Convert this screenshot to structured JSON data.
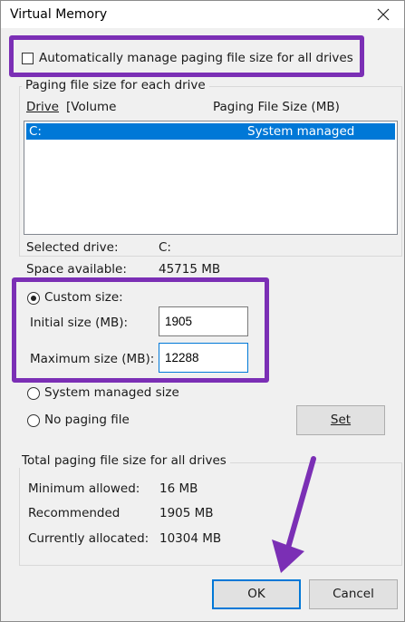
{
  "window": {
    "title": "Virtual Memory"
  },
  "auto_manage": {
    "label": "Automatically manage paging file size for all drives",
    "checked": false
  },
  "drives_group": {
    "title": "Paging file size for each drive",
    "columns": {
      "drive": "Drive",
      "volume": "[Volume",
      "size": "Paging File Size (MB)"
    },
    "rows": [
      {
        "drive": "C:",
        "size": "System managed",
        "selected": true
      }
    ]
  },
  "selected_drive": {
    "label": "Selected drive:",
    "value": "C:"
  },
  "space_available": {
    "label": "Space available:",
    "value": "45715 MB"
  },
  "custom_size": {
    "label": "Custom size:",
    "selected": true
  },
  "initial_size": {
    "label": "Initial size (MB):",
    "value": "1905"
  },
  "maximum_size": {
    "label": "Maximum size (MB):",
    "value": "12288"
  },
  "system_managed": {
    "label": "System managed size",
    "selected": false
  },
  "no_paging": {
    "label": "No paging file",
    "selected": false
  },
  "set_button": {
    "label": "Set"
  },
  "total_group": {
    "title": "Total paging file size for all drives",
    "minimum": {
      "label": "Minimum allowed:",
      "value": "16 MB"
    },
    "recommended": {
      "label": "Recommended",
      "value": "1905 MB"
    },
    "allocated": {
      "label": "Currently allocated:",
      "value": "10304 MB"
    }
  },
  "ok_button": {
    "label": "OK"
  },
  "cancel_button": {
    "label": "Cancel"
  },
  "colors": {
    "highlight": "#7b2fb5",
    "selection": "#0078d7"
  }
}
